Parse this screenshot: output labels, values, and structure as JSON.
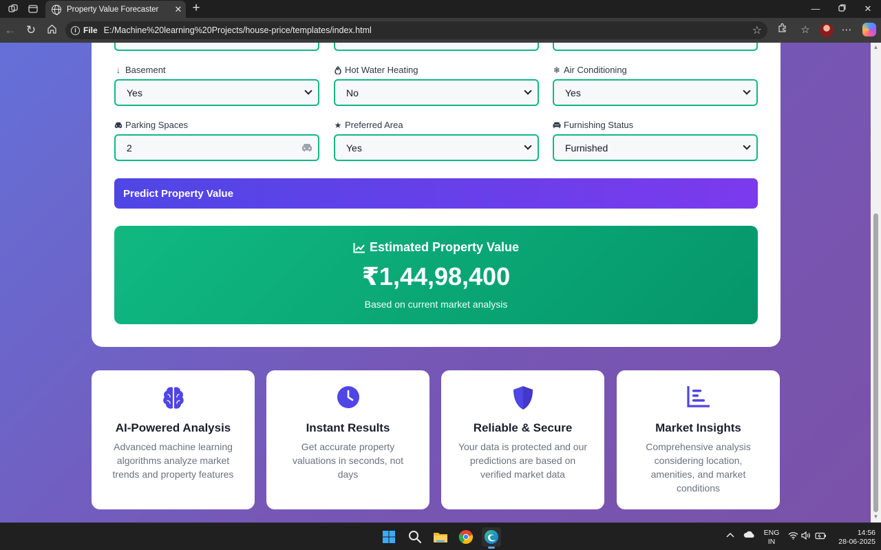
{
  "browser": {
    "tab_title": "Property Value Forecaster",
    "file_label": "File",
    "url": "E:/Machine%20learning%20Projects/house-price/templates/index.html"
  },
  "form": {
    "fields": [
      {
        "label": "Basement",
        "value": "Yes",
        "icon": "arrow-down-icon",
        "kind": "select"
      },
      {
        "label": "Hot Water Heating",
        "value": "No",
        "icon": "flame-icon",
        "kind": "select"
      },
      {
        "label": "Air Conditioning",
        "value": "Yes",
        "icon": "snowflake-icon",
        "kind": "select"
      },
      {
        "label": "Parking Spaces",
        "value": "2",
        "icon": "car-icon",
        "kind": "number"
      },
      {
        "label": "Preferred Area",
        "value": "Yes",
        "icon": "star-icon",
        "kind": "select"
      },
      {
        "label": "Furnishing Status",
        "value": "Furnished",
        "icon": "couch-icon",
        "kind": "select"
      }
    ],
    "predict_button": "Predict Property Value"
  },
  "result": {
    "title": "Estimated Property Value",
    "value": "₹1,44,98,400",
    "note": "Based on current market analysis"
  },
  "features": [
    {
      "title": "AI-Powered Analysis",
      "description": "Advanced machine learning algorithms analyze market trends and property features",
      "icon": "brain-icon"
    },
    {
      "title": "Instant Results",
      "description": "Get accurate property valuations in seconds, not days",
      "icon": "clock-icon"
    },
    {
      "title": "Reliable & Secure",
      "description": "Your data is protected and our predictions are based on verified market data",
      "icon": "shield-icon"
    },
    {
      "title": "Market Insights",
      "description": "Comprehensive analysis considering location, amenities, and market conditions",
      "icon": "bar-chart-icon"
    }
  ],
  "colors": {
    "accent_green": "#10b981",
    "button_gradient_start": "#4f46e5",
    "button_gradient_end": "#7c3aed",
    "icon_purple": "#4f46e5"
  },
  "taskbar": {
    "lang_line1": "ENG",
    "lang_line2": "IN",
    "time": "14:56",
    "date": "28-06-2025"
  }
}
